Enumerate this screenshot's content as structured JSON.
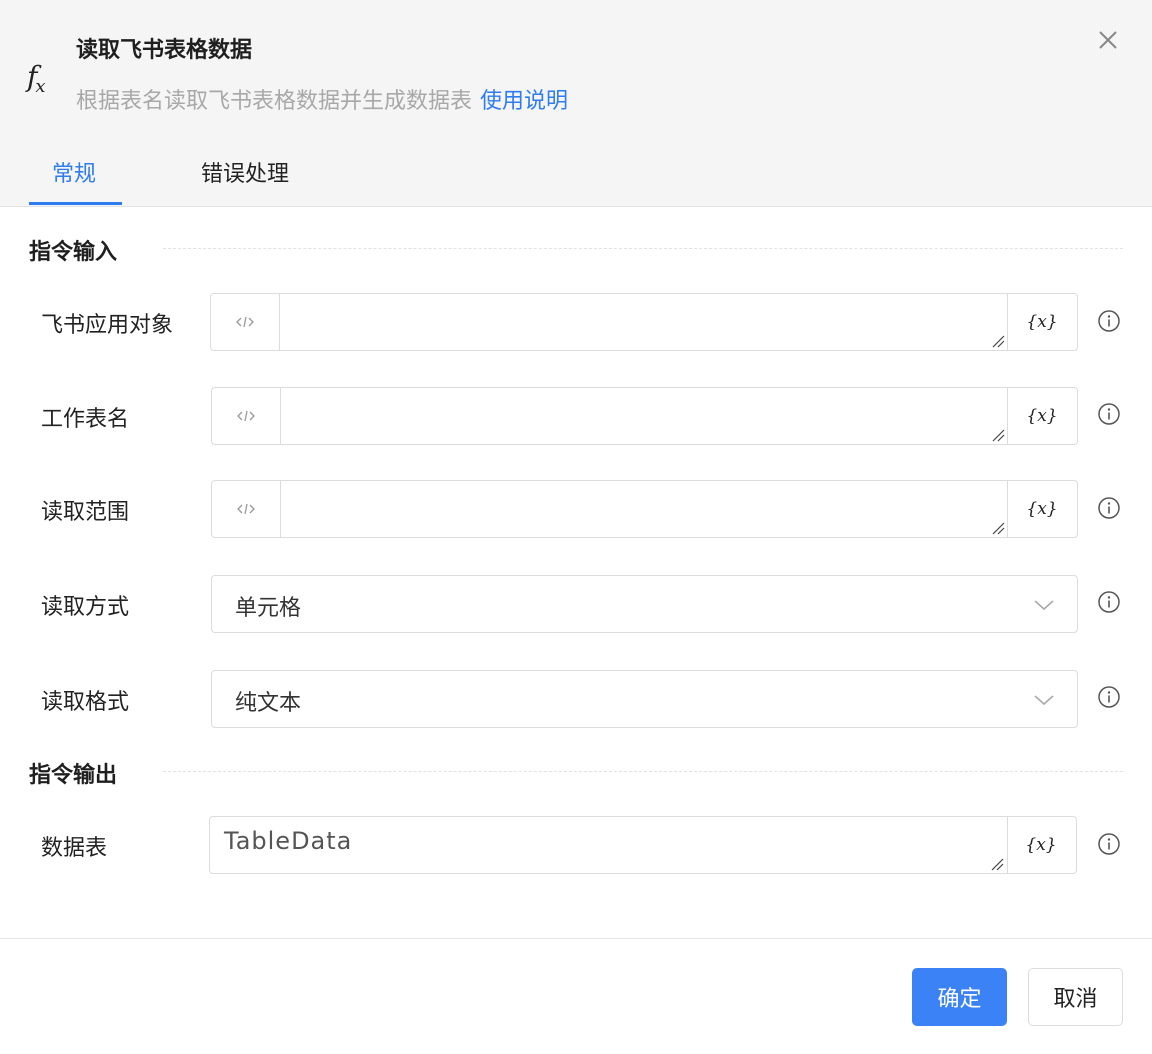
{
  "header": {
    "icon": "function-icon",
    "title": "读取飞书表格数据",
    "subtitle": "根据表名读取飞书表格数据并生成数据表",
    "help_link": "使用说明"
  },
  "tabs": [
    {
      "label": "常规",
      "active": true
    },
    {
      "label": "错误处理",
      "active": false
    }
  ],
  "input_section": {
    "title": "指令输入",
    "fields": [
      {
        "label": "飞书应用对象",
        "value": "",
        "var_label": "{x}"
      },
      {
        "label": "工作表名",
        "value": "",
        "var_label": "{x}"
      },
      {
        "label": "读取范围",
        "value": "",
        "var_label": "{x}"
      }
    ],
    "selects": [
      {
        "label": "读取方式",
        "value": "单元格"
      },
      {
        "label": "读取格式",
        "value": "纯文本"
      }
    ]
  },
  "output_section": {
    "title": "指令输出",
    "fields": [
      {
        "label": "数据表",
        "value": "TableData",
        "var_label": "{x}"
      }
    ]
  },
  "footer": {
    "confirm_label": "确定",
    "cancel_label": "取消"
  },
  "colors": {
    "accent": "#2f7cf0",
    "primary_button": "#3b82f6",
    "header_bg": "#f5f5f5"
  }
}
